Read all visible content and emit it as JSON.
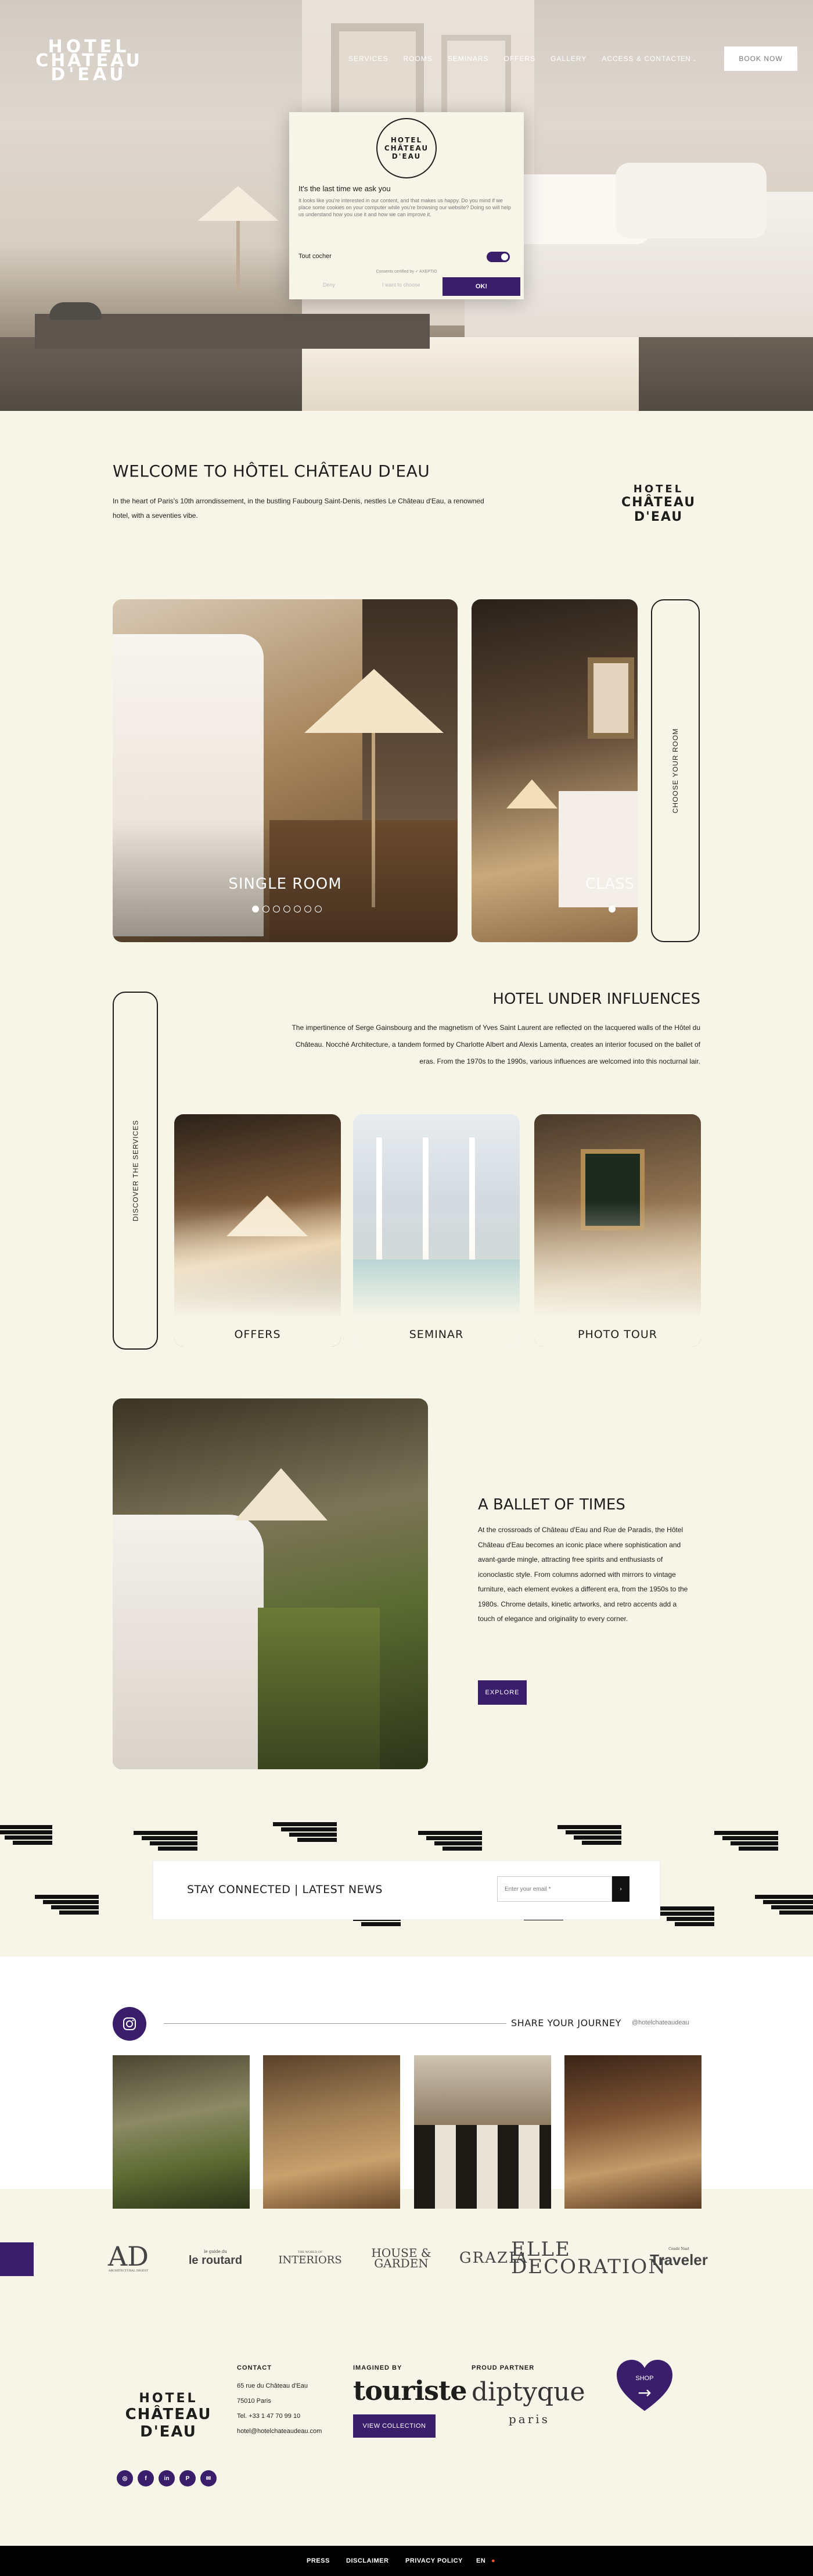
{
  "header": {
    "logo": {
      "line1": "HOTEL",
      "line2": "CHÂTEAU",
      "line3": "D'EAU"
    },
    "nav": [
      "SERVICES",
      "ROOMS",
      "SEMINARS",
      "OFFERS",
      "GALLERY",
      "ACCESS & CONTACT"
    ],
    "language": "EN",
    "language_icon": "chevron-down-icon",
    "book_now": "BOOK NOW"
  },
  "cookie_banner": {
    "title": "It's the last time we ask you",
    "text": "It looks like you're interested in our content, and that makes us happy. Do you mind if we place some cookies on your computer while you're browsing our website? Doing so will help us understand how you use it and how we can improve it.",
    "toggle_label": "Tout cocher",
    "toggle_on": true,
    "consent_note": "Consents certified by ✓ AXEPTIO",
    "deny": "Deny",
    "customize": "I want to choose",
    "ok": "OK!"
  },
  "welcome": {
    "title": "WELCOME TO HÔTEL CHÂTEAU D'EAU",
    "text": "In the heart of Paris's 10th arrondissement, in the bustling Faubourg Saint-Denis, nestles Le Château d'Eau, a renowned hotel, with a seventies vibe."
  },
  "rooms": {
    "slides": [
      "SINGLE ROOM",
      "CLASS"
    ],
    "dot_count": 7,
    "active_dot": 0,
    "choose_label": "CHOOSE YOUR ROOM"
  },
  "influences": {
    "discover_label": "DISCOVER THE SERVICES",
    "title": "HOTEL UNDER INFLUENCES",
    "text": "The impertinence of Serge Gainsbourg and the magnetism of Yves Saint Laurent are reflected on the lacquered walls of the Hôtel du Château. Nocché Architecture, a tandem formed by Charlotte Albert and Alexis Lamenta, creates an interior focused on the ballet of eras. From the 1970s to the 1990s, various influences are welcomed into this nocturnal lair.",
    "services": [
      "OFFERS",
      "SEMINAR",
      "PHOTO TOUR"
    ]
  },
  "ballet": {
    "title": "A BALLET OF TIMES",
    "text": "At the crossroads of Château d'Eau and Rue de Paradis, the Hôtel Château d'Eau becomes an iconic place where sophistication and avant-garde mingle, attracting free spirits and enthusiasts of iconoclastic style. From columns adorned with mirrors to vintage furniture, each element evokes a different era, from the 1950s to the 1980s. Chrome details, kinetic artworks, and retro accents add a touch of elegance and originality to every corner.",
    "cta": "EXPLORE"
  },
  "newsletter": {
    "title": "STAY CONNECTED | LATEST NEWS",
    "placeholder": "Enter your email *",
    "submit": "›"
  },
  "social": {
    "icon": "instagram-icon",
    "title": "SHARE YOUR JOURNEY",
    "handle": "@hotelchateaudeau"
  },
  "press": [
    "AD",
    "le routard",
    "INTERIORS",
    "HOUSE & GARDEN",
    "GRAZIA",
    "ELLE DECORATION",
    "Traveler"
  ],
  "press_sub": {
    "ad": "ARCHITECTURAL DIGEST",
    "routard": "le guide du",
    "interiors": "THE WORLD OF",
    "elle": "DÉCORATION",
    "traveler": "Condé Nast"
  },
  "footer": {
    "contact_heading": "CONTACT",
    "address1": "65 rue du Château d'Eau",
    "address2": "75010 Paris",
    "phone": "Tel. +33 1 47 70 99 10",
    "email": "hotel@hotelchateaudeau.com",
    "imagined_heading": "IMAGINED BY",
    "imagined_brand": "touriste",
    "view_collection": "VIEW COLLECTION",
    "partner_heading": "PROUD PARTNER",
    "partner_brand": "diptyque",
    "partner_city": "paris",
    "shop": "SHOP",
    "social_icons": [
      "instagram-icon",
      "facebook-icon",
      "linkedin-icon",
      "pinterest-icon",
      "email-icon"
    ]
  },
  "bottom_bar": {
    "links": [
      "PRESS",
      "DISCLAIMER",
      "PRIVACY POLICY"
    ],
    "lang": "EN"
  },
  "colors": {
    "accent": "#3b1e6b",
    "background": "#f7f5e8",
    "text": "#1d1d1b"
  }
}
